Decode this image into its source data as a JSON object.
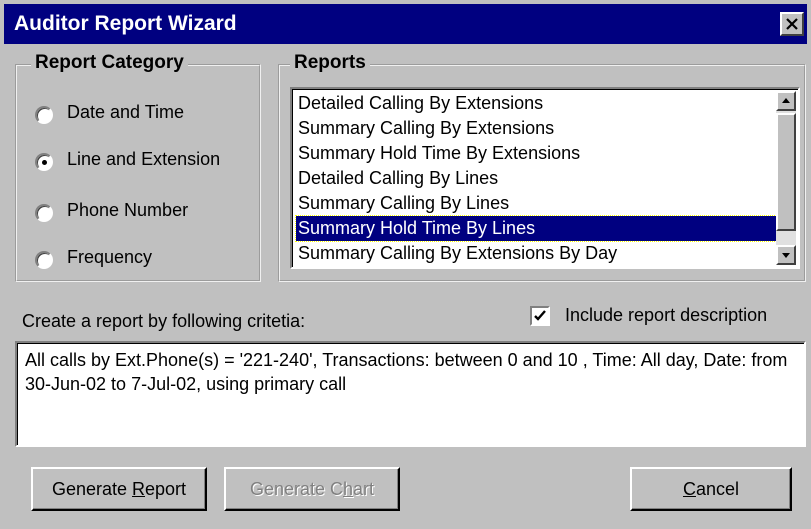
{
  "window": {
    "title": "Auditor Report Wizard"
  },
  "report_category": {
    "legend": "Report Category",
    "options": [
      {
        "label": "Date and Time",
        "selected": false
      },
      {
        "label": "Line and Extension",
        "selected": true
      },
      {
        "label": "Phone Number",
        "selected": false
      },
      {
        "label": "Frequency",
        "selected": false
      }
    ]
  },
  "reports": {
    "legend": "Reports",
    "items": [
      "Detailed Calling By Extensions",
      "Summary Calling By Extensions",
      "Summary Hold Time By Extensions",
      "Detailed Calling By Lines",
      "Summary Calling By Lines",
      "Summary Hold Time By Lines",
      "Summary Calling By Extensions By Day"
    ],
    "selected_index": 5
  },
  "criteria": {
    "label": "Create a report by following critetia:",
    "include_description_label": "Include report description",
    "include_description_checked": true,
    "text": "All calls by Ext.Phone(s) = '221-240',  Transactions: between 0 and 10 , Time: All day, Date: from 30-Jun-02 to 7-Jul-02,  using primary call"
  },
  "buttons": {
    "generate_report": {
      "pre": "Generate ",
      "mnemonic": "R",
      "post": "eport"
    },
    "generate_chart": {
      "pre": "Generate C",
      "mnemonic": "h",
      "post": "art"
    },
    "cancel": {
      "pre": "",
      "mnemonic": "C",
      "post": "ancel"
    }
  },
  "colors": {
    "titlebar": "#000080",
    "face": "#c0c0c0",
    "selection": "#000080"
  }
}
